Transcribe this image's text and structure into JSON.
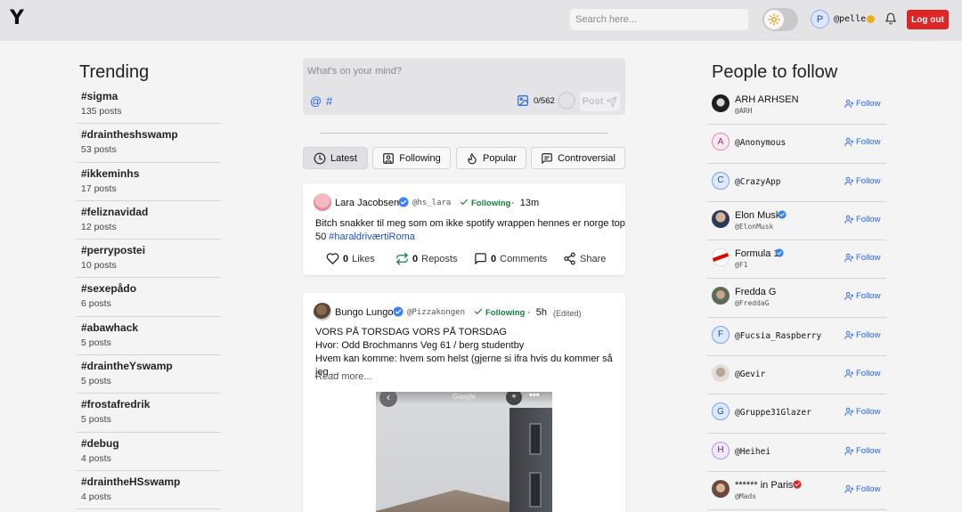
{
  "header": {
    "logo": "Y",
    "search_placeholder": "Search here...",
    "user_initial": "P",
    "username": "@pelle",
    "logout_label": "Log out",
    "theme_icon": "sun-icon"
  },
  "trending": {
    "title": "Trending",
    "items": [
      {
        "tag": "#sigma",
        "count": "135 posts"
      },
      {
        "tag": "#draintheshswamp",
        "count": "53 posts"
      },
      {
        "tag": "#ikkeminhs",
        "count": "17 posts"
      },
      {
        "tag": "#feliznavidad",
        "count": "12 posts"
      },
      {
        "tag": "#perrypostei",
        "count": "10 posts"
      },
      {
        "tag": "#sexepådo",
        "count": "6 posts"
      },
      {
        "tag": "#abawhack",
        "count": "5 posts"
      },
      {
        "tag": "#draintheYswamp",
        "count": "5 posts"
      },
      {
        "tag": "#frostafredrik",
        "count": "5 posts"
      },
      {
        "tag": "#debug",
        "count": "4 posts"
      },
      {
        "tag": "#draintheHSswamp",
        "count": "4 posts"
      }
    ]
  },
  "composer": {
    "placeholder": "What's on your mind?",
    "mention": "@",
    "hash": "#",
    "char_count": "0/562",
    "post_label": "Post"
  },
  "tabs": [
    {
      "label": "Latest",
      "icon": "clock-icon",
      "active": true
    },
    {
      "label": "Following",
      "icon": "user-square-icon",
      "active": false
    },
    {
      "label": "Popular",
      "icon": "flame-icon",
      "active": false
    },
    {
      "label": "Controversial",
      "icon": "message-square-icon",
      "active": false
    }
  ],
  "posts": [
    {
      "name": "Lara Jacobsen",
      "handle": "@hs_lara",
      "following": "Following",
      "time": "13m",
      "text_line1": "Bitch snakker til meg som om ikke spotify wrappen hennes er norge top",
      "text_line2_prefix": "50 ",
      "hashtag": "#haraldriværtiRoma",
      "likes": "0",
      "likes_label": "Likes",
      "reposts": "0",
      "reposts_label": "Reposts",
      "comments": "0",
      "comments_label": "Comments",
      "share_label": "Share"
    },
    {
      "name": "Bungo Lungo",
      "handle": "@Pizzakongen",
      "following": "Following",
      "time": "5h",
      "edited": "(Edited)",
      "line1": "VORS PÅ TORSDAG VORS PÅ TORSDAG",
      "line2": "Hvor: Odd Brochmanns Veg 61 / berg studentby",
      "line3": "Hvem kan komme: hvem som helst (gjerne si ifra hvis du kommer så jeg ...",
      "read_more": "Read more...",
      "image_label": "Google"
    }
  ],
  "people": {
    "title": "People to follow",
    "follow_label": "Follow",
    "items": [
      {
        "name": "ARH ARHSEN",
        "handle": "@ARH",
        "avatar": "photo",
        "mono": false,
        "verified": ""
      },
      {
        "name": "@Anonymous",
        "handle": "",
        "avatar": "A",
        "mono": true,
        "verified": ""
      },
      {
        "name": "@CrazyApp",
        "handle": "",
        "avatar": "C",
        "mono": true,
        "verified": ""
      },
      {
        "name": "Elon Musk",
        "handle": "@ElonMusk",
        "avatar": "photo",
        "mono": false,
        "verified": "blue"
      },
      {
        "name": "Formula 1",
        "handle": "@F1",
        "avatar": "photo",
        "mono": false,
        "verified": "blue"
      },
      {
        "name": "Fredda G",
        "handle": "@FreddaG",
        "avatar": "photo",
        "mono": false,
        "verified": ""
      },
      {
        "name": "@Fucsia_Raspberry",
        "handle": "",
        "avatar": "F",
        "mono": true,
        "verified": ""
      },
      {
        "name": "@Gevir",
        "handle": "",
        "avatar": "photo",
        "mono": true,
        "verified": ""
      },
      {
        "name": "@Gruppe31Glazer",
        "handle": "",
        "avatar": "G",
        "mono": true,
        "verified": ""
      },
      {
        "name": "@Heihei",
        "handle": "",
        "avatar": "H",
        "mono": true,
        "verified": ""
      },
      {
        "name": "****** in Paris",
        "handle": "@Mads",
        "avatar": "photo",
        "mono": false,
        "verified": "red"
      }
    ]
  },
  "colors": {
    "accent": "#2563eb",
    "logout": "#dc2626",
    "following": "#15803d",
    "verified_blue": "#3b82f6",
    "verified_red": "#dc2626",
    "hashtag": "#1d4ed8"
  }
}
